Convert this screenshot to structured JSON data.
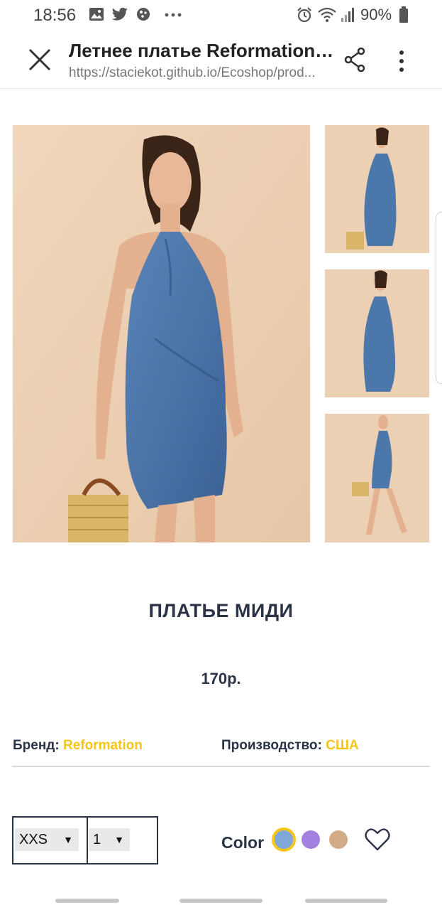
{
  "status_bar": {
    "time": "18:56",
    "notification_icons": [
      "gallery-icon",
      "twitter-icon",
      "settings-app-icon",
      "more-dots-icon"
    ],
    "system_icons": [
      "alarm-icon",
      "wifi-icon",
      "signal-icon",
      "battery-icon"
    ],
    "battery_percent": "90%"
  },
  "toolbar": {
    "title": "Летнее платье Reformation к...",
    "url": "https://staciekot.github.io/Ecoshop/prod..."
  },
  "gallery": {
    "main_image": "woman-in-blue-halter-dress-photo",
    "thumbnails": [
      "dress-front-thumb",
      "dress-side-thumb",
      "dress-walking-thumb"
    ]
  },
  "product": {
    "name": "ПЛАТЬЕ МИДИ",
    "price": "170р.",
    "brand_label": "Бренд:",
    "brand_value": "Reformation",
    "origin_label": "Производство:",
    "origin_value": "США"
  },
  "options": {
    "size_selected": "XXS",
    "quantity_selected": "1",
    "color_label": "Color",
    "colors": [
      "#7fa7d8",
      "#a37fe0",
      "#d1ab85"
    ],
    "selected_color_ring": "#f5c51b"
  },
  "colors": {
    "accent": "#f5c51b",
    "text_dark": "#2b3446"
  }
}
